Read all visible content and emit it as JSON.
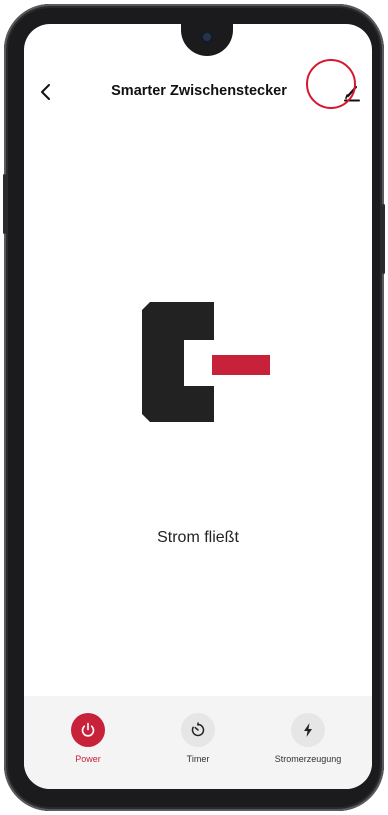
{
  "header": {
    "title": "Smarter Zwischenstecker",
    "back_icon": "chevron-left-icon",
    "edit_icon": "pencil-icon"
  },
  "main": {
    "status_text": "Strom fließt"
  },
  "tabs": [
    {
      "label": "Power",
      "icon": "power-icon",
      "active": true
    },
    {
      "label": "Timer",
      "icon": "timer-icon",
      "active": false
    },
    {
      "label": "Stromerzeugung",
      "icon": "lightning-icon",
      "active": false
    }
  ],
  "colors": {
    "accent": "#c8213a",
    "logo_dark": "#222222",
    "tab_bar": "#f4f4f4",
    "highlight": "#d7172f"
  }
}
